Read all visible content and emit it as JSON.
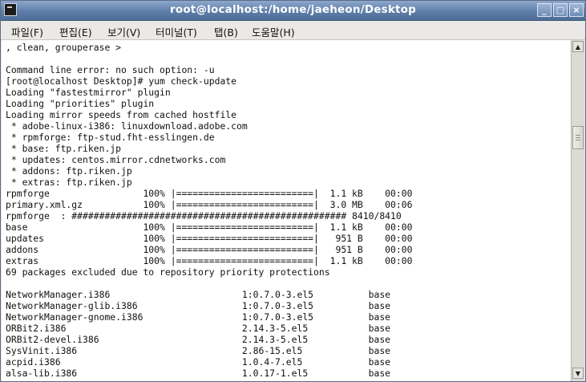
{
  "window": {
    "title": "root@localhost:/home/jaeheon/Desktop",
    "controls": {
      "minimize": "_",
      "maximize": "□",
      "close": "×"
    }
  },
  "menubar": {
    "items": [
      "파일(F)",
      "편집(E)",
      "보기(V)",
      "터미널(T)",
      "탭(B)",
      "도움말(H)"
    ]
  },
  "terminal": {
    "lines": [
      ", clean, grouperase >",
      "",
      "Command line error: no such option: -u",
      "[root@localhost Desktop]# yum check-update",
      "Loading \"fastestmirror\" plugin",
      "Loading \"priorities\" plugin",
      "Loading mirror speeds from cached hostfile",
      " * adobe-linux-i386: linuxdownload.adobe.com",
      " * rpmforge: ftp-stud.fht-esslingen.de",
      " * base: ftp.riken.jp",
      " * updates: centos.mirror.cdnetworks.com",
      " * addons: ftp.riken.jp",
      " * extras: ftp.riken.jp",
      "rpmforge                 100% |=========================|  1.1 kB    00:00",
      "primary.xml.gz           100% |=========================|  3.0 MB    00:06",
      "rpmforge  : ################################################## 8410/8410",
      "base                     100% |=========================|  1.1 kB    00:00",
      "updates                  100% |=========================|   951 B    00:00",
      "addons                   100% |=========================|   951 B    00:00",
      "extras                   100% |=========================|  1.1 kB    00:00",
      "69 packages excluded due to repository priority protections",
      "",
      "NetworkManager.i386                        1:0.7.0-3.el5          base",
      "NetworkManager-glib.i386                   1:0.7.0-3.el5          base",
      "NetworkManager-gnome.i386                  1:0.7.0-3.el5          base",
      "ORBit2.i386                                2.14.3-5.el5           base",
      "ORBit2-devel.i386                          2.14.3-5.el5           base",
      "SysVinit.i386                              2.86-15.el5            base",
      "acpid.i386                                 1.0.4-7.el5            base",
      "alsa-lib.i386                              1.0.17-1.el5           base"
    ]
  },
  "scrollbar": {
    "up": "▲",
    "down": "▼"
  }
}
